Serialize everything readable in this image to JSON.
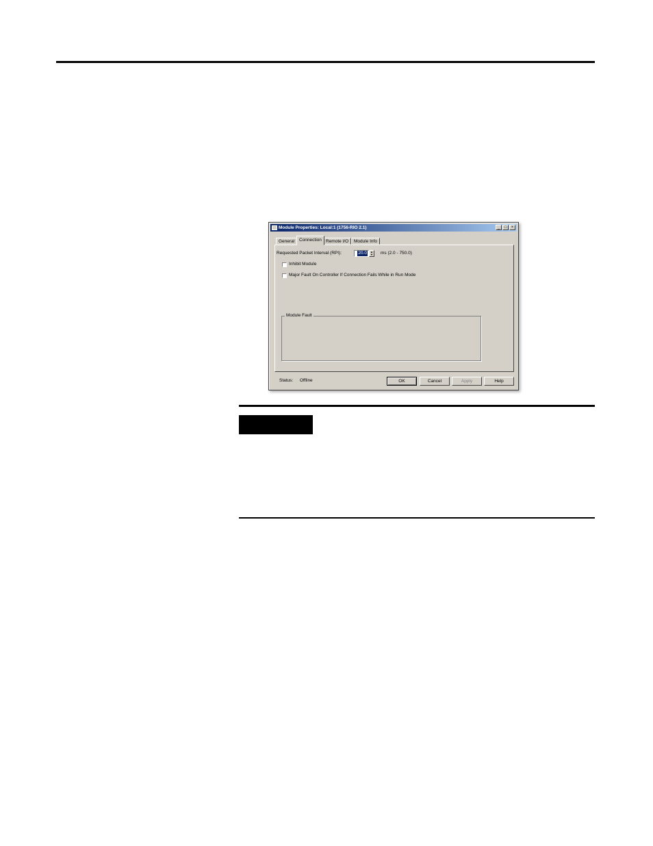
{
  "dialog": {
    "title": "Module Properties: Local:1 (1756-RIO 2.1)",
    "window_buttons": {
      "minimize": "_",
      "maximize": "□",
      "close": "×"
    },
    "tabs": [
      "General",
      "Connection",
      "Remote I/O",
      "Module Info"
    ],
    "active_tab": "Connection",
    "rpi": {
      "label": "Requested Packet Interval (RPI):",
      "value": "20.0",
      "range": "ms (2.0 - 750.0)"
    },
    "inhibit_module": {
      "label": "Inhibit Module",
      "checked": false
    },
    "major_fault": {
      "label": "Major Fault On Controller If Connection Fails While in Run Mode",
      "checked": false
    },
    "module_fault": {
      "legend": "Module Fault"
    },
    "status": {
      "label": "Status:",
      "value": "Offline"
    },
    "buttons": {
      "ok": "OK",
      "cancel": "Cancel",
      "apply": "Apply",
      "help": "Help"
    }
  }
}
